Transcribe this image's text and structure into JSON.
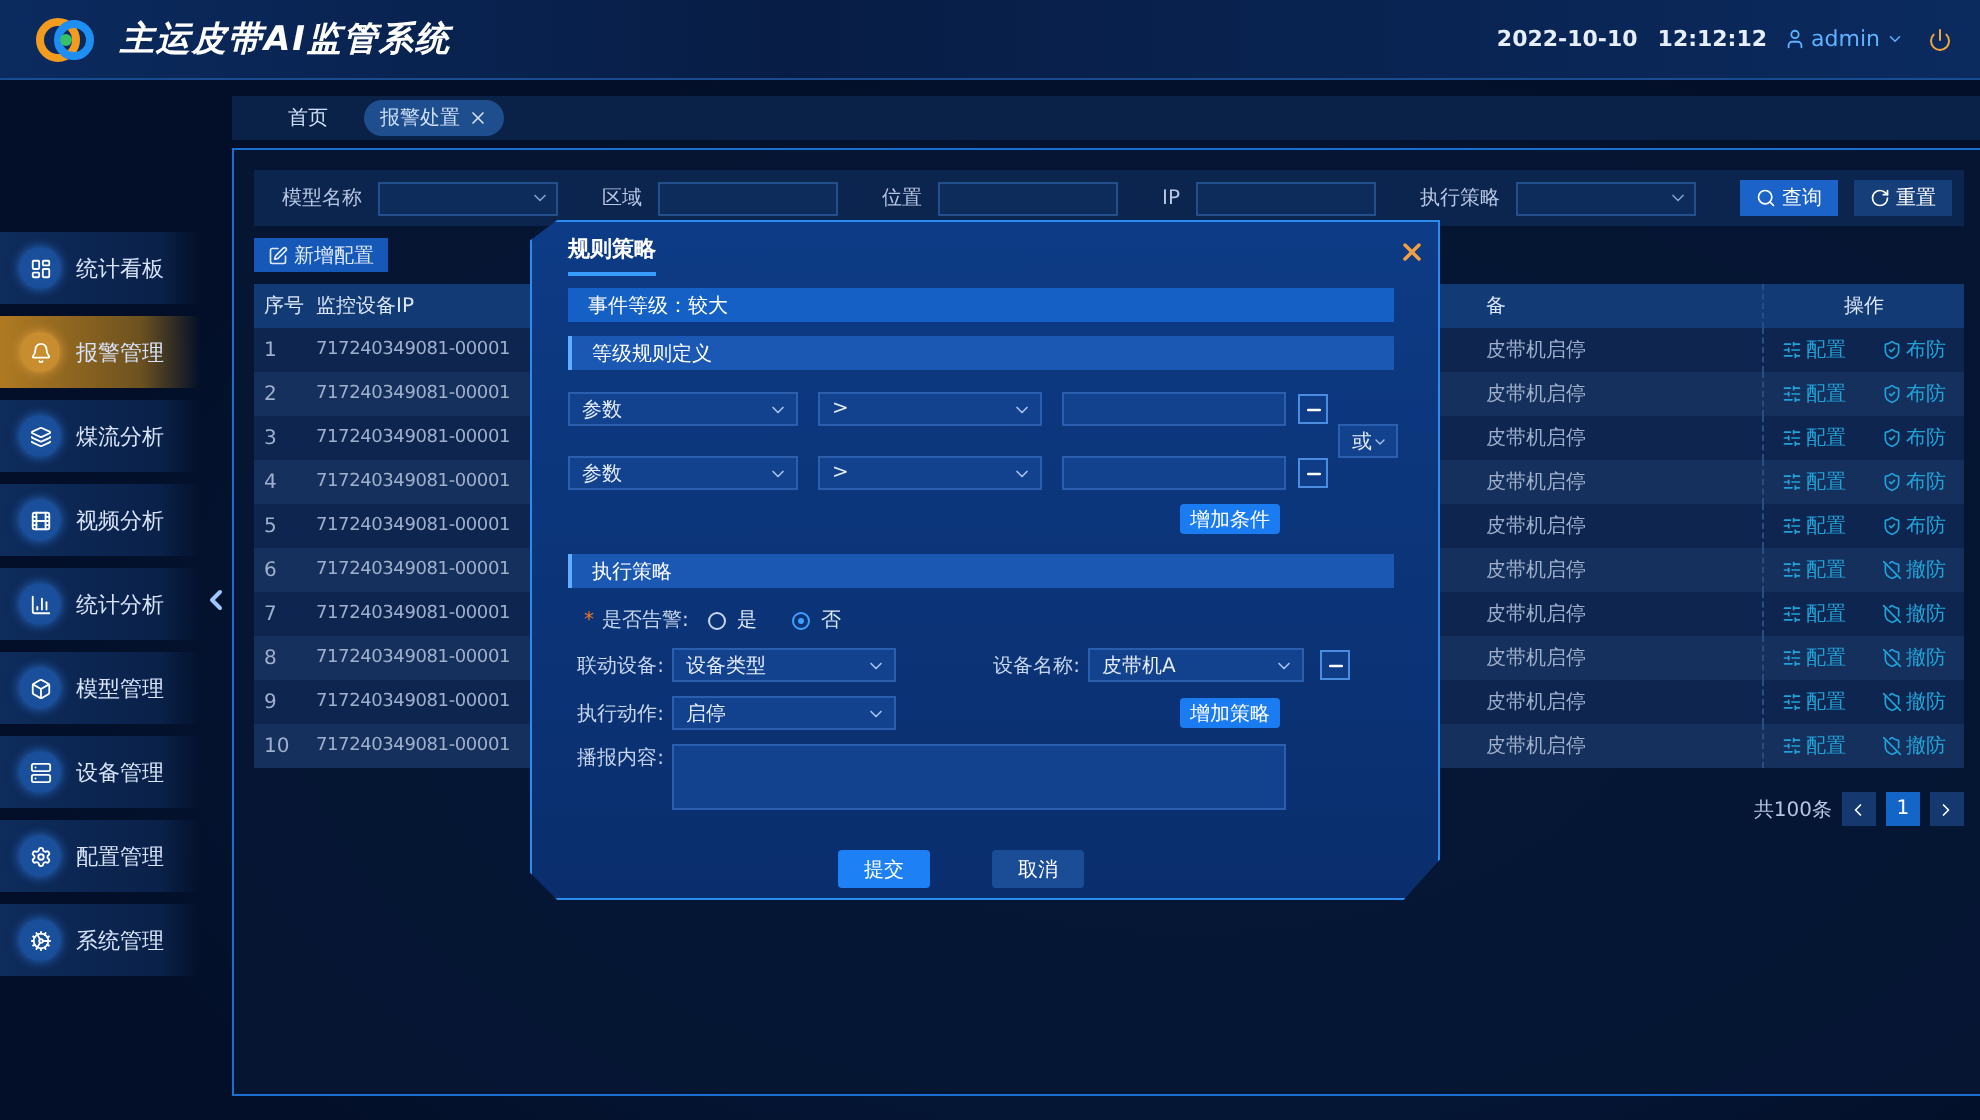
{
  "header": {
    "title": "主运皮带AI监管系统",
    "date": "2022-10-10",
    "time": "12:12:12",
    "user": "admin"
  },
  "sidebar": {
    "items": [
      {
        "label": "统计看板",
        "selected": false
      },
      {
        "label": "报警管理",
        "selected": true
      },
      {
        "label": "煤流分析",
        "selected": false
      },
      {
        "label": "视频分析",
        "selected": false
      },
      {
        "label": "统计分析",
        "selected": false
      },
      {
        "label": "模型管理",
        "selected": false
      },
      {
        "label": "设备管理",
        "selected": false
      },
      {
        "label": "配置管理",
        "selected": false
      },
      {
        "label": "系统管理",
        "selected": false
      }
    ]
  },
  "tabs": [
    {
      "label": "首页",
      "selected": false,
      "closable": false
    },
    {
      "label": "报警处置",
      "selected": true,
      "closable": true
    }
  ],
  "filters": [
    {
      "label": "模型名称",
      "kind": "select"
    },
    {
      "label": "区域",
      "kind": "input"
    },
    {
      "label": "位置",
      "kind": "input"
    },
    {
      "label": "IP",
      "kind": "input"
    },
    {
      "label": "执行策略",
      "kind": "select"
    }
  ],
  "filter_buttons": [
    {
      "label": "查询",
      "kind": "query"
    },
    {
      "label": "重置",
      "kind": "reset"
    }
  ],
  "new_button": "新增配置",
  "table": {
    "columns": [
      "序号",
      "监控设备IP",
      "备",
      "操作"
    ],
    "rows": [
      {
        "index": "1",
        "ip": "717240349081-00001",
        "column_3": "皮带机启停",
        "actions": [
          {
            "label": "配置",
            "kind": "config"
          },
          {
            "label": "布防",
            "kind": "arm"
          }
        ]
      },
      {
        "index": "2",
        "ip": "717240349081-00001",
        "column_3": "皮带机启停",
        "actions": [
          {
            "label": "配置",
            "kind": "config"
          },
          {
            "label": "布防",
            "kind": "arm"
          }
        ]
      },
      {
        "index": "3",
        "ip": "717240349081-00001",
        "column_3": "皮带机启停",
        "actions": [
          {
            "label": "配置",
            "kind": "config"
          },
          {
            "label": "布防",
            "kind": "arm"
          }
        ]
      },
      {
        "index": "4",
        "ip": "717240349081-00001",
        "column_3": "皮带机启停",
        "actions": [
          {
            "label": "配置",
            "kind": "config"
          },
          {
            "label": "布防",
            "kind": "arm"
          }
        ]
      },
      {
        "index": "5",
        "ip": "717240349081-00001",
        "column_3": "皮带机启停",
        "actions": [
          {
            "label": "配置",
            "kind": "config"
          },
          {
            "label": "布防",
            "kind": "arm"
          }
        ]
      },
      {
        "index": "6",
        "ip": "717240349081-00001",
        "column_3": "皮带机启停",
        "actions": [
          {
            "label": "配置",
            "kind": "config"
          },
          {
            "label": "撤防",
            "kind": "disarm"
          }
        ]
      },
      {
        "index": "7",
        "ip": "717240349081-00001",
        "column_3": "皮带机启停",
        "actions": [
          {
            "label": "配置",
            "kind": "config"
          },
          {
            "label": "撤防",
            "kind": "disarm"
          }
        ]
      },
      {
        "index": "8",
        "ip": "717240349081-00001",
        "column_3": "皮带机启停",
        "actions": [
          {
            "label": "配置",
            "kind": "config"
          },
          {
            "label": "撤防",
            "kind": "disarm"
          }
        ]
      },
      {
        "index": "9",
        "ip": "717240349081-00001",
        "column_3": "皮带机启停",
        "actions": [
          {
            "label": "配置",
            "kind": "config"
          },
          {
            "label": "撤防",
            "kind": "disarm"
          }
        ]
      },
      {
        "index": "10",
        "ip": "717240349081-00001",
        "column_3": "皮带机启停",
        "actions": [
          {
            "label": "配置",
            "kind": "config"
          },
          {
            "label": "撤防",
            "kind": "disarm"
          }
        ]
      }
    ]
  },
  "pagination": {
    "total": "共100条",
    "pages": [
      {
        "label": "1",
        "selected": true
      }
    ]
  },
  "modal": {
    "title": "规则策略",
    "event_level": "事件等级：较大",
    "rule_section": "等级规则定义",
    "conditions": [
      {
        "field": "参数",
        "operator": ">"
      },
      {
        "field": "参数",
        "operator": ">"
      }
    ],
    "logic": "或",
    "add_condition": "增加条件",
    "strategy_section": "执行策略",
    "alarm": {
      "required_mark": "*",
      "label": "是否告警:",
      "options": [
        {
          "label": "是",
          "selected": false
        },
        {
          "label": "否",
          "selected": true
        }
      ]
    },
    "linkage": {
      "label": "联动设备:",
      "value": "设备类型"
    },
    "device_name": {
      "label": "设备名称:",
      "value": "皮带机A"
    },
    "action": {
      "label": "执行动作:",
      "value": "启停"
    },
    "add_strategy": "增加策略",
    "broadcast": {
      "label": "播报内容:"
    },
    "buttons": [
      {
        "label": "提交",
        "kind": "primary"
      },
      {
        "label": "取消",
        "kind": "secondary"
      }
    ]
  }
}
